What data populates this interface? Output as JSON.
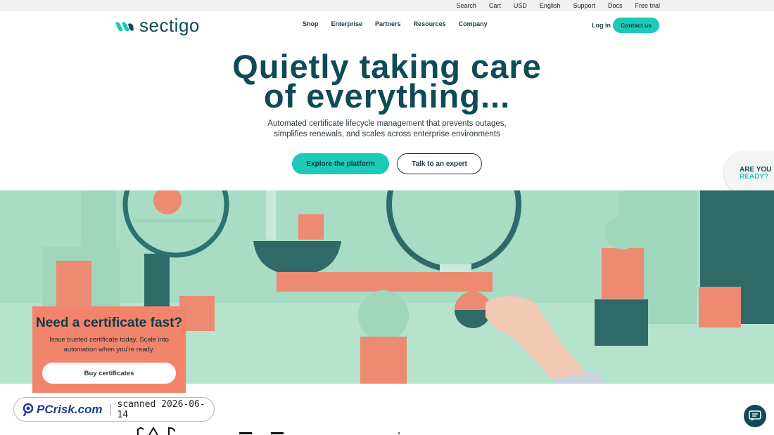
{
  "topbar": {
    "links": [
      "Search",
      "Cart",
      "USD",
      "English",
      "Support",
      "Docs",
      "Free trial"
    ]
  },
  "nav": {
    "brand": "sectigo",
    "menu": [
      "Shop",
      "Enterprise",
      "Partners",
      "Resources",
      "Company"
    ],
    "login": "Log in",
    "contact": "Contact us"
  },
  "hero": {
    "title_line1": "Quietly taking care",
    "title_line2": "of everything...",
    "subtitle_line1": "Automated certificate lifecycle management that prevents outages,",
    "subtitle_line2": "simplifies renewals, and scales across enterprise environments",
    "primary_button": "Explore the platform",
    "secondary_button": "Talk to an expert"
  },
  "ready_tab": {
    "line1": "ARE YOU",
    "line2": "READY?"
  },
  "promo_card": {
    "title": "Need a certificate fast?",
    "text_line1": "Issue trusted certificate today. Scale into",
    "text_line2": "automation when you're ready.",
    "button": "Buy certificates"
  },
  "watermark": {
    "brand": "PCrisk.com",
    "scanned": "scanned 2026-06-14"
  },
  "colors": {
    "brand_teal": "#0e4b57",
    "accent": "#1dc9b7",
    "coral": "#f1846b",
    "mint": "#a9dcc4"
  },
  "icons": {
    "logo": "sectigo-logo-icon",
    "chat": "chat-icon"
  }
}
